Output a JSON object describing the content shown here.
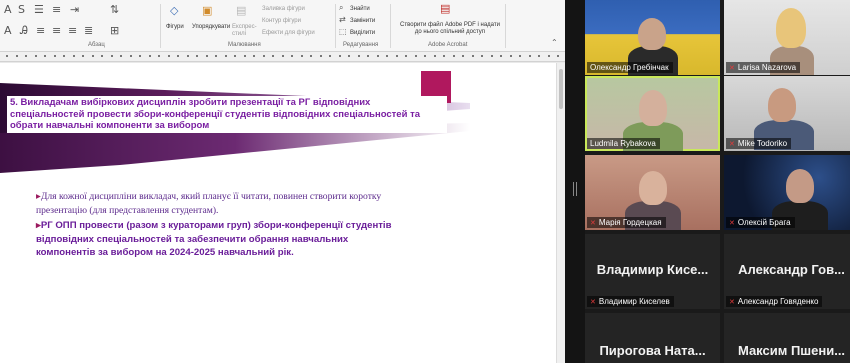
{
  "ribbon": {
    "groups": [
      "Абзац",
      "Малювання",
      "Редагування",
      "Adobe Acrobat"
    ],
    "items": {
      "shapes": "Фігури",
      "arrange": "Упорядкувати",
      "quick_styles": "Експрес-стилі",
      "shape_fill": "Заливка фігури",
      "shape_outline": "Контур фігури",
      "shape_effects": "Ефекти для фігури",
      "find": "Знайти",
      "replace": "Замінити",
      "select": "Виділити",
      "adobe_pdf": "Створити файл Adobe PDF і надати до нього спільний доступ"
    }
  },
  "slide": {
    "banner_text": "5.  Викладачам вибіркових дисциплін зробити презентації та РГ відповідних спеціальностей провести збори-конференції студентів відповідних спеціальностей  та обрати навчальні компоненти за вибором",
    "bullet1": "Для кожної дисципліни викладач, який планує її читати,  повинен створити коротку презентацію (для представлення студентам).",
    "bullet2": "РГ ОПП провести (разом з кураторами груп)  збори-конференції студентів  відповідних спеціальностей  та забезпечити  обрання навчальних компонентів за вибором на 2024-2025 навчальний рік.",
    "arrow_glyph": "▸",
    "colors": {
      "banner_gradient_start": "#3a1040",
      "banner_gradient_end": "#d8c9e6",
      "accent": "#b0185e",
      "text": "#6a1d99"
    }
  },
  "participants": [
    {
      "name": "Олександр Гребінчак",
      "muted": false,
      "video": true
    },
    {
      "name": "Larisa Nazarova",
      "muted": true,
      "video": true
    },
    {
      "name": "Ludmila Rybakova",
      "muted": false,
      "video": true,
      "active_speaker": true
    },
    {
      "name": "Mike Todoriko",
      "muted": true,
      "video": true
    },
    {
      "name": "Марія Гордецкая",
      "muted": true,
      "video": true
    },
    {
      "name": "Олексій Брага",
      "muted": true,
      "video": true
    },
    {
      "name": "Владимир Киселев",
      "display": "Владимир  Кисе...",
      "muted": true,
      "video": false
    },
    {
      "name": "Александр Говяденко",
      "display": "Александр  Гов...",
      "muted": true,
      "video": false
    },
    {
      "display": "Пирогова  Ната...",
      "video": false
    },
    {
      "display": "Максим  Пшени...",
      "video": false
    }
  ],
  "icons": {
    "mic_muted": "mic-off-icon"
  }
}
